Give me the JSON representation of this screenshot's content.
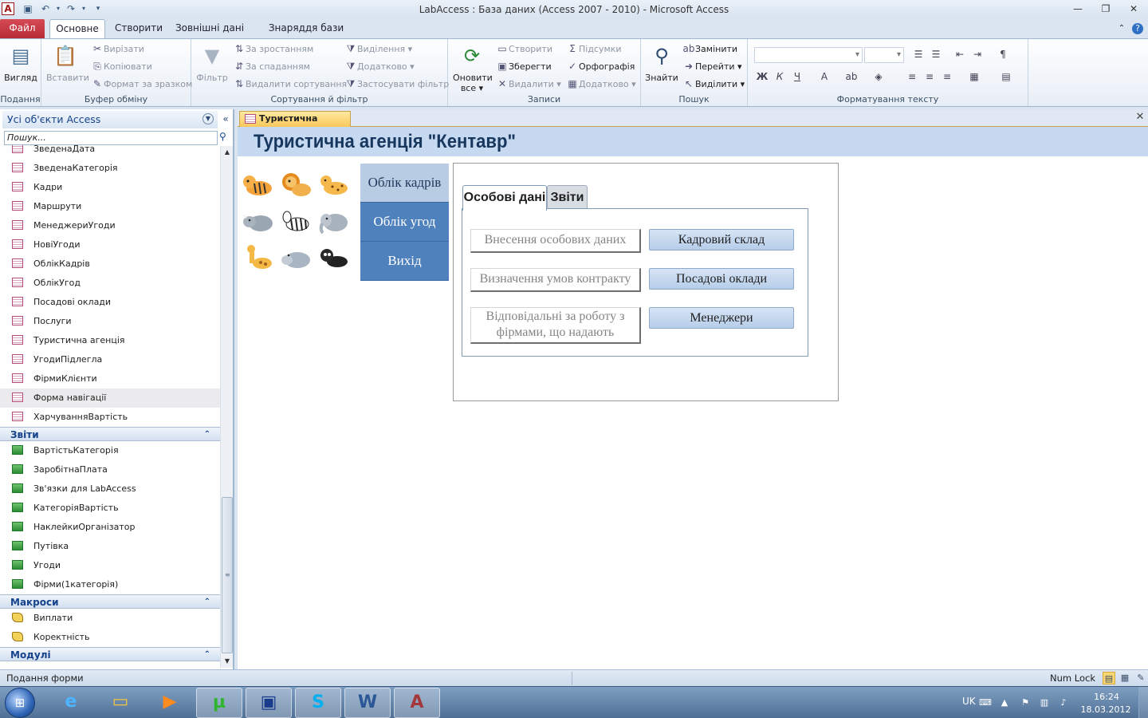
{
  "titlebar": {
    "title": "LabAccess : База даних (Access 2007 - 2010)  -  Microsoft Access",
    "app_icon": "A",
    "minimize": "—",
    "maximize": "❐",
    "close": "✕"
  },
  "ribbon_tabs": [
    "Файл",
    "Основне",
    "Створити",
    "Зовнішні дані",
    "Знаряддя бази даних"
  ],
  "ribbon": {
    "views_group": "Подання",
    "view_btn": "Вигляд",
    "clipboard_group": "Буфер обміну",
    "paste_btn": "Вставити",
    "cut": "Вирізати",
    "copy": "Копіювати",
    "format_painter": "Формат за зразком",
    "sort_group": "Сортування й фільтр",
    "filter_btn": "Фільтр",
    "asc": "За зростанням",
    "desc": "За спаданням",
    "remove_sort": "Видалити сортування",
    "selection": "Виділення",
    "advanced": "Додатково",
    "toggle_filter": "Застосувати фільтр",
    "records_group": "Записи",
    "refresh_l1": "Оновити",
    "refresh_l2": "все",
    "new_rec": "Створити",
    "save_rec": "Зберегти",
    "delete_rec": "Видалити",
    "totals": "Підсумки",
    "spelling": "Орфографія",
    "more": "Додатково",
    "find_group": "Пошук",
    "find_btn": "Знайти",
    "replace": "Замінити",
    "goto": "Перейти",
    "select": "Виділити",
    "format_group": "Форматування тексту"
  },
  "nav": {
    "header": "Усі об'єкти Access",
    "search_placeholder": "Пошук...",
    "forms": [
      "ЗведенаДата",
      "ЗведенаКатегорія",
      "Кадри",
      "Маршрути",
      "МенеджериУгоди",
      "НовіУгоди",
      "ОблікКадрів",
      "ОблікУгод",
      "Посадові оклади",
      "Послуги",
      "Туристична агенція",
      "УгодиПідлегла",
      "ФірмиКлієнти",
      "Форма навігації",
      "ХарчуванняВартість"
    ],
    "reports_header": "Звіти",
    "reports": [
      "ВартістьКатегорія",
      "ЗаробітнаПлата",
      "Зв'язки для LabAccess",
      "КатегоріяВартість",
      "НаклейкиОрганізатор",
      "Путівка",
      "Угоди",
      "Фірми(1категорія)"
    ],
    "macros_header": "Макроси",
    "macros": [
      "Виплати",
      "Коректність"
    ],
    "modules_header": "Модулі"
  },
  "doc": {
    "tab": "Туристична агенція",
    "title": "Туристична агенція \"Кентавр\"",
    "nav_buttons": [
      "Облік кадрів",
      "Облік угод",
      "Вихід"
    ],
    "tabs": [
      "Особові дані",
      "Звіти"
    ],
    "labels": [
      "Внесення особових даних",
      "Визначення умов контракту",
      "Відповідальні за роботу з фірмами, що надають"
    ],
    "buttons": [
      "Кадровий склад",
      "Посадові оклади",
      "Менеджери"
    ]
  },
  "status": {
    "left": "Подання форми",
    "numlock": "Num Lock"
  },
  "tray": {
    "lang": "UK",
    "time": "16:24",
    "date": "18.03.2012"
  }
}
